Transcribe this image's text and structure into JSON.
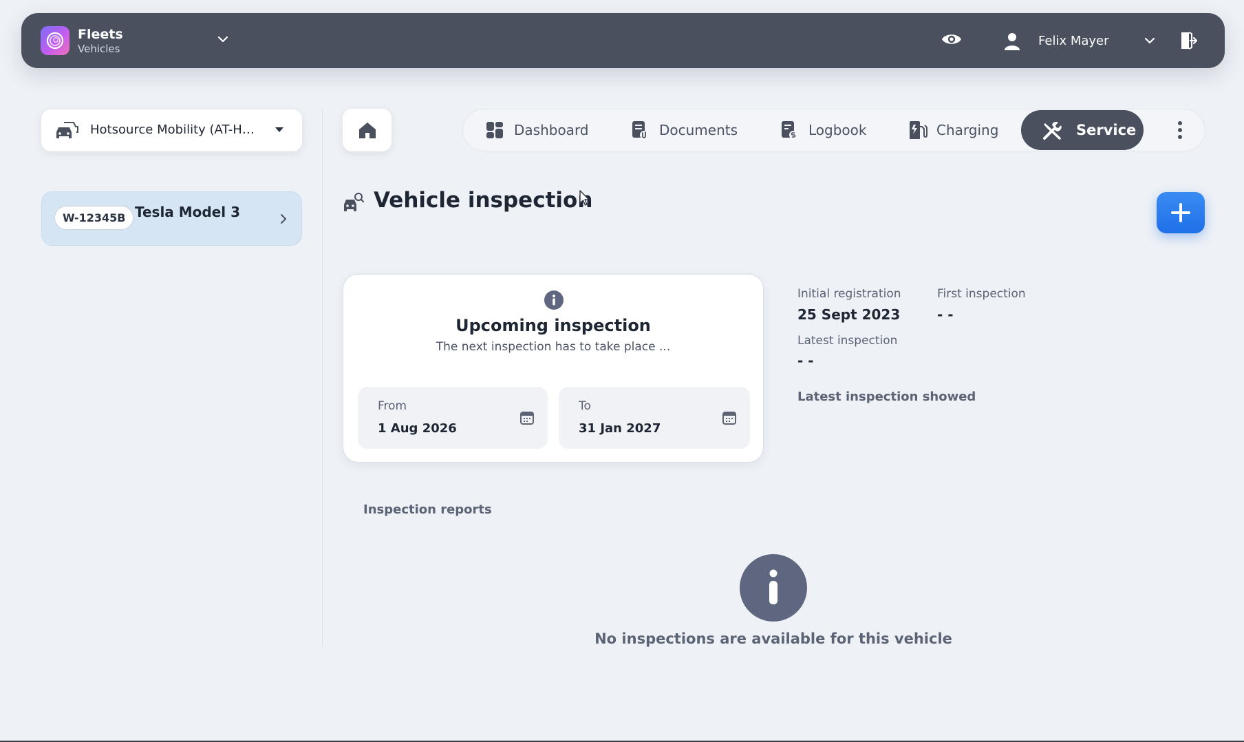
{
  "topbar": {
    "app_name": "Fleets",
    "app_subtitle": "Vehicles",
    "user_name": "Felix Mayer"
  },
  "sidebar": {
    "organization": "Hotsource Mobility (AT-HM...",
    "vehicles": [
      {
        "plate": "W-12345B",
        "name": "Tesla Model 3"
      }
    ]
  },
  "nav": {
    "tabs": [
      {
        "label": "Dashboard",
        "icon": "dashboard-icon"
      },
      {
        "label": "Documents",
        "icon": "documents-icon"
      },
      {
        "label": "Logbook",
        "icon": "logbook-icon"
      },
      {
        "label": "Charging",
        "icon": "charging-icon"
      },
      {
        "label": "Service",
        "icon": "service-icon",
        "active": true
      }
    ]
  },
  "page": {
    "title": "Vehicle inspection"
  },
  "upcoming": {
    "title": "Upcoming inspection",
    "subtitle": "The next inspection has to take place ...",
    "from_label": "From",
    "from_value": "1 Aug 2026",
    "to_label": "To",
    "to_value": "31 Jan 2027"
  },
  "meta": {
    "initial_registration_label": "Initial registration",
    "initial_registration_value": "25 Sept 2023",
    "first_inspection_label": "First inspection",
    "first_inspection_value": "- -",
    "latest_inspection_label": "Latest inspection",
    "latest_inspection_value": "- -",
    "latest_inspection_showed": "Latest inspection showed"
  },
  "reports": {
    "label": "Inspection reports",
    "empty_text": "No inspections are available for this vehicle"
  },
  "colors": {
    "topbar": "#4a505e",
    "accent": "#1f6fe8",
    "selected_vehicle": "#d5e5f3",
    "background": "#eef1f6"
  }
}
